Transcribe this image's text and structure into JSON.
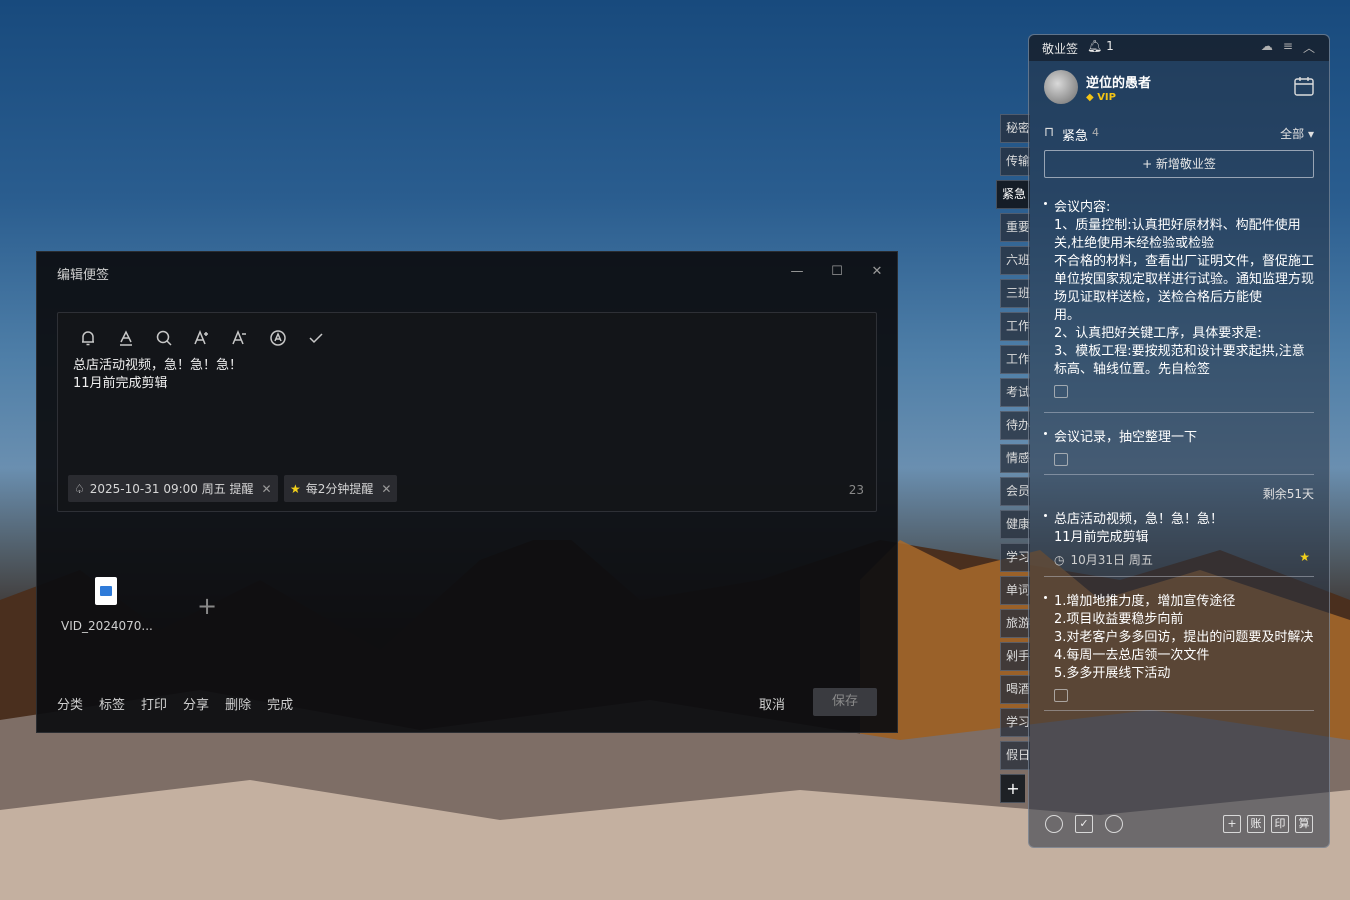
{
  "editor": {
    "title": "编辑便签",
    "controls": {
      "minimize": "—",
      "maximize": "☐",
      "close": "✕"
    },
    "note_text": "总店活动视频，急！急！急！\n11月前完成剪辑",
    "reminder_chip": "2025-10-31 09:00 周五 提醒",
    "repeat_chip": "每2分钟提醒",
    "char_count": "23",
    "attachment_name": "VID_2024070...",
    "actions": [
      "分类",
      "标签",
      "打印",
      "分享",
      "删除",
      "完成"
    ],
    "cancel_label": "取消",
    "save_label": "保存"
  },
  "side_tabs": [
    "秘密",
    "传输",
    "紧急",
    "重要",
    "六班",
    "三班",
    "工作",
    "工作",
    "考试",
    "待办",
    "情感",
    "会员",
    "健康",
    "学习",
    "单词",
    "旅游",
    "剁手",
    "喝酒",
    "学习",
    "假日"
  ],
  "panel": {
    "app_title": "敬业签",
    "bell_count": "1",
    "username": "逆位的愚者",
    "vip_label": "VIP",
    "category": "紧急",
    "category_count": "4",
    "filter_label": "全部",
    "new_note_label": "+ 新增敬业签",
    "notes": [
      {
        "text": "会议内容:\n1、质量控制:认真把好原材料、构配件使用关,杜绝使用未经检验或检验\n不合格的材料，查看出厂证明文件，督促施工单位按国家规定取样进行试验。通知监理方现场见证取样送检，送检合格后方能使\n用。\n2、认真把好关键工序，具体要求是:\n3、模板工程:要按规范和设计要求起拱,注意标高、轴线位置。先自检签"
      },
      {
        "text": "会议记录，抽空整理一下"
      },
      {
        "text": "总店活动视频，急！急！急！\n11月前完成剪辑",
        "remain": "剩余51天",
        "date": "10月31日 周五"
      },
      {
        "text": "1.增加地推力度，增加宣传途径\n2.项目收益要稳步向前\n3.对老客户多多回访，提出的问题要及时解决\n4.每周一去总店领一次文件\n5.多多开展线下活动"
      }
    ],
    "footer_right": [
      "+",
      "账",
      "印",
      "算"
    ]
  },
  "colors": {
    "star": "#f3d11a",
    "vip": "#f3c316"
  }
}
